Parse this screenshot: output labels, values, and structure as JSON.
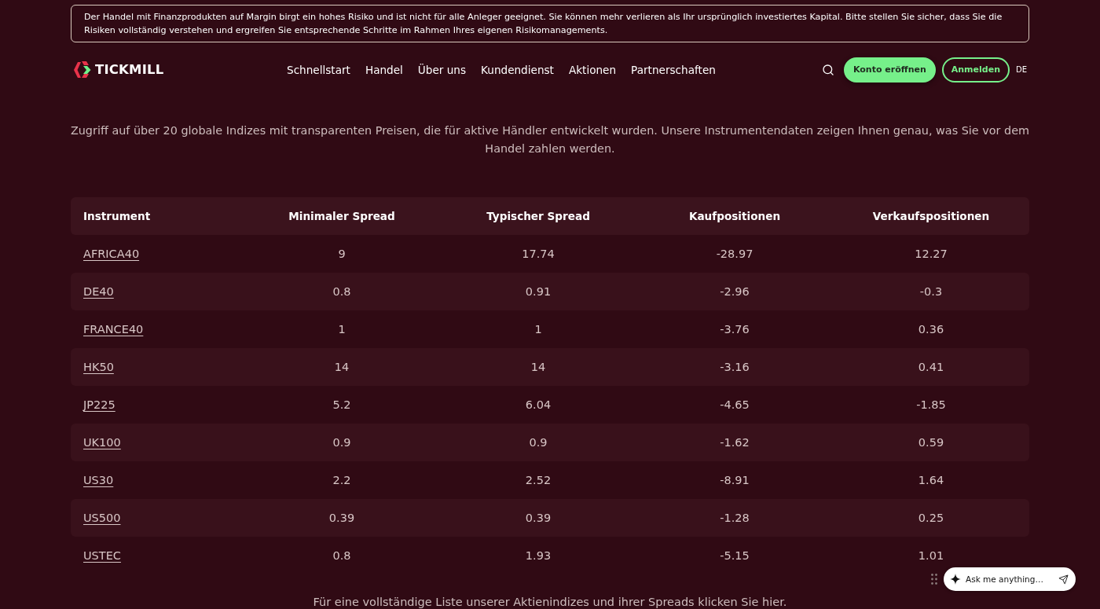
{
  "risk_warning": "Der Handel mit Finanzprodukten auf Margin birgt ein hohes Risiko und ist nicht für alle Anleger geeignet. Sie können mehr verlieren als Ihr ursprünglich investiertes Kapital. Bitte stellen Sie sicher, dass Sie die Risiken vollständig verstehen und ergreifen Sie entsprechende Schritte im Rahmen Ihres eigenen Risikomanagements.",
  "header": {
    "logo": "TICKMILL",
    "nav": [
      "Schnellstart",
      "Handel",
      "Über uns",
      "Kundendienst",
      "Aktionen",
      "Partnerschaften"
    ],
    "buttons": [
      {
        "label": "Konto eröffnen",
        "kind": "primary"
      },
      {
        "label": "Anmelden",
        "kind": "outline"
      }
    ],
    "language": "DE"
  },
  "intro": "Zugriff auf über 20 globale Indizes mit transparenten Preisen, die für aktive Händler entwickelt wurden. Unsere Instrumentendaten zeigen Ihnen genau, was Sie vor dem Handel zahlen werden.",
  "table": {
    "columns": [
      "Instrument",
      "Minimaler Spread",
      "Typischer Spread",
      "Kaufpositionen",
      "Verkaufspositionen"
    ],
    "rows": [
      {
        "cells": [
          "AFRICA40",
          "9",
          "17.74",
          "-28.97",
          "12.27"
        ]
      },
      {
        "cells": [
          "DE40",
          "0.8",
          "0.91",
          "-2.96",
          "-0.3"
        ]
      },
      {
        "cells": [
          "FRANCE40",
          "1",
          "1",
          "-3.76",
          "0.36"
        ]
      },
      {
        "cells": [
          "HK50",
          "14",
          "14",
          "-3.16",
          "0.41"
        ]
      },
      {
        "cells": [
          "JP225",
          "5.2",
          "6.04",
          "-4.65",
          "-1.85"
        ]
      },
      {
        "cells": [
          "UK100",
          "0.9",
          "0.9",
          "-1.62",
          "0.59"
        ]
      },
      {
        "cells": [
          "US30",
          "2.2",
          "2.52",
          "-8.91",
          "1.64"
        ]
      },
      {
        "cells": [
          "US500",
          "0.39",
          "0.39",
          "-1.28",
          "0.25"
        ]
      },
      {
        "cells": [
          "USTEC",
          "0.8",
          "1.93",
          "-5.15",
          "1.01"
        ]
      }
    ]
  },
  "footnote": "Für eine vollständige Liste unserer Aktienindizes und ihrer Spreads klicken Sie hier.",
  "chat": {
    "placeholder": "Ask me anything…"
  }
}
